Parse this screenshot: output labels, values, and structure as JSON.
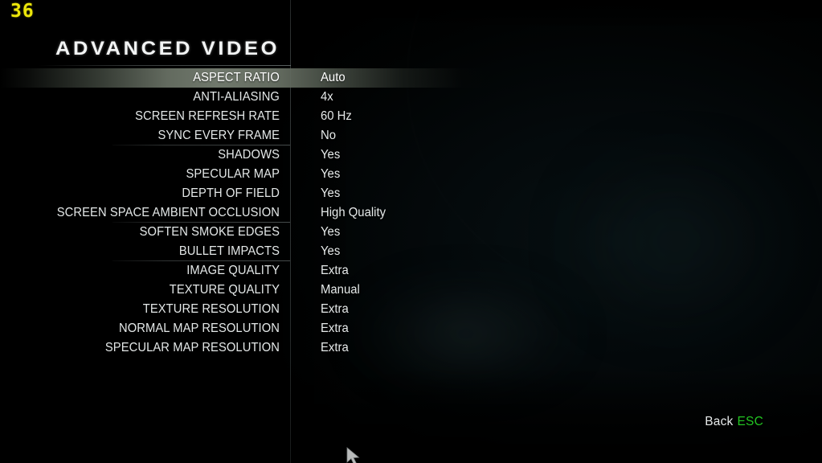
{
  "hud": {
    "fps_counter": "36"
  },
  "menu": {
    "title": "ADVANCED VIDEO",
    "selected_index": 0,
    "options": [
      {
        "label": "ASPECT RATIO",
        "value": "Auto",
        "selected": true,
        "separator_after": false
      },
      {
        "label": "ANTI-ALIASING",
        "value": "4x",
        "selected": false,
        "separator_after": false
      },
      {
        "label": "SCREEN REFRESH RATE",
        "value": "60 Hz",
        "selected": false,
        "separator_after": false
      },
      {
        "label": "SYNC EVERY FRAME",
        "value": "No",
        "selected": false,
        "separator_after": true
      },
      {
        "label": "SHADOWS",
        "value": "Yes",
        "selected": false,
        "separator_after": false
      },
      {
        "label": "SPECULAR MAP",
        "value": "Yes",
        "selected": false,
        "separator_after": false
      },
      {
        "label": "DEPTH OF FIELD",
        "value": "Yes",
        "selected": false,
        "separator_after": false
      },
      {
        "label": "SCREEN SPACE AMBIENT OCCLUSION",
        "value": "High Quality",
        "selected": false,
        "separator_after": true
      },
      {
        "label": "SOFTEN SMOKE EDGES",
        "value": "Yes",
        "selected": false,
        "separator_after": false
      },
      {
        "label": "BULLET IMPACTS",
        "value": "Yes",
        "selected": false,
        "separator_after": true
      },
      {
        "label": "IMAGE QUALITY",
        "value": "Extra",
        "selected": false,
        "separator_after": false
      },
      {
        "label": "TEXTURE QUALITY",
        "value": "Manual",
        "selected": false,
        "separator_after": false
      },
      {
        "label": "TEXTURE RESOLUTION",
        "value": "Extra",
        "selected": false,
        "separator_after": false
      },
      {
        "label": "NORMAL MAP RESOLUTION",
        "value": "Extra",
        "selected": false,
        "separator_after": false
      },
      {
        "label": "SPECULAR MAP RESOLUTION",
        "value": "Extra",
        "selected": false,
        "separator_after": false
      }
    ]
  },
  "footer": {
    "back_label": "Back",
    "back_key": "ESC"
  },
  "colors": {
    "fps_yellow": "#ece60a",
    "key_green": "#22c522",
    "text_white": "#e6eaea",
    "highlight_bar": "#707868",
    "background": "#000000"
  },
  "cursor": {
    "icon": "mouse-pointer-icon"
  }
}
